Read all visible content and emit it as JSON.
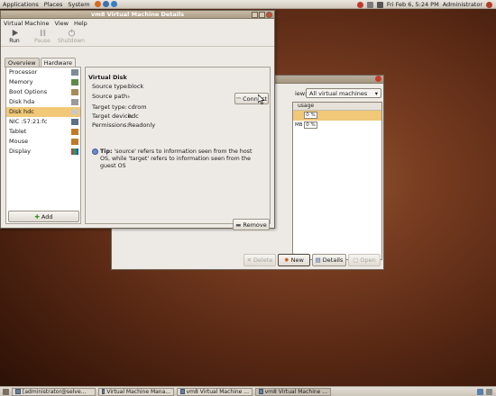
{
  "top_panel": {
    "menus": [
      "Applications",
      "Places",
      "System"
    ],
    "clock": "Fri Feb 6,  5:24 PM",
    "user": "Administrator"
  },
  "details_window": {
    "title": "vm8 Virtual Machine Details",
    "menus": [
      "Virtual Machine",
      "View",
      "Help"
    ],
    "toolbar": {
      "run": "Run",
      "pause": "Pause",
      "shutdown": "Shutdown"
    },
    "tabs": [
      "Overview",
      "Hardware"
    ],
    "hardware_items": [
      "Processor",
      "Memory",
      "Boot Options",
      "Disk hda",
      "Disk hdc",
      "NIC :57:21:fc",
      "Tablet",
      "Mouse",
      "Display"
    ],
    "add_label": "Add",
    "section_title": "Virtual Disk",
    "fields": {
      "source_type_label": "Source type:",
      "source_type_value": "block",
      "source_path_label": "Source path:",
      "source_path_value": "-",
      "target_type_label": "Target type:",
      "target_type_value": "cdrom",
      "target_device_label": "Target device:",
      "target_device_value": "hdc",
      "permissions_label": "Permissions:",
      "permissions_value": "Readonly"
    },
    "connect_label": "Connect",
    "tip_bold": "Tip:",
    "tip_text": " 'source' refers to information seen from the host OS, while 'target' refers to information seen from the guest OS",
    "remove_label": "Remove"
  },
  "manager_window": {
    "view_label": "iew:",
    "view_selected": "All virtual machines",
    "column_usage": "usage",
    "rows": [
      {
        "mem": "",
        "usage": "0 %"
      },
      {
        "mem": "MB",
        "usage": "0 %"
      }
    ],
    "buttons": {
      "delete": "Delete",
      "new": "New",
      "details": "Details",
      "open": "Open"
    }
  },
  "taskbar": [
    "[administrator@selve...",
    "Virtual Machine Mana...",
    "vm8 Virtual Machine ...",
    "vm8 Virtual Machine ..."
  ],
  "colors": {
    "selection": "#f0c878",
    "desktop": "#6a3219"
  }
}
